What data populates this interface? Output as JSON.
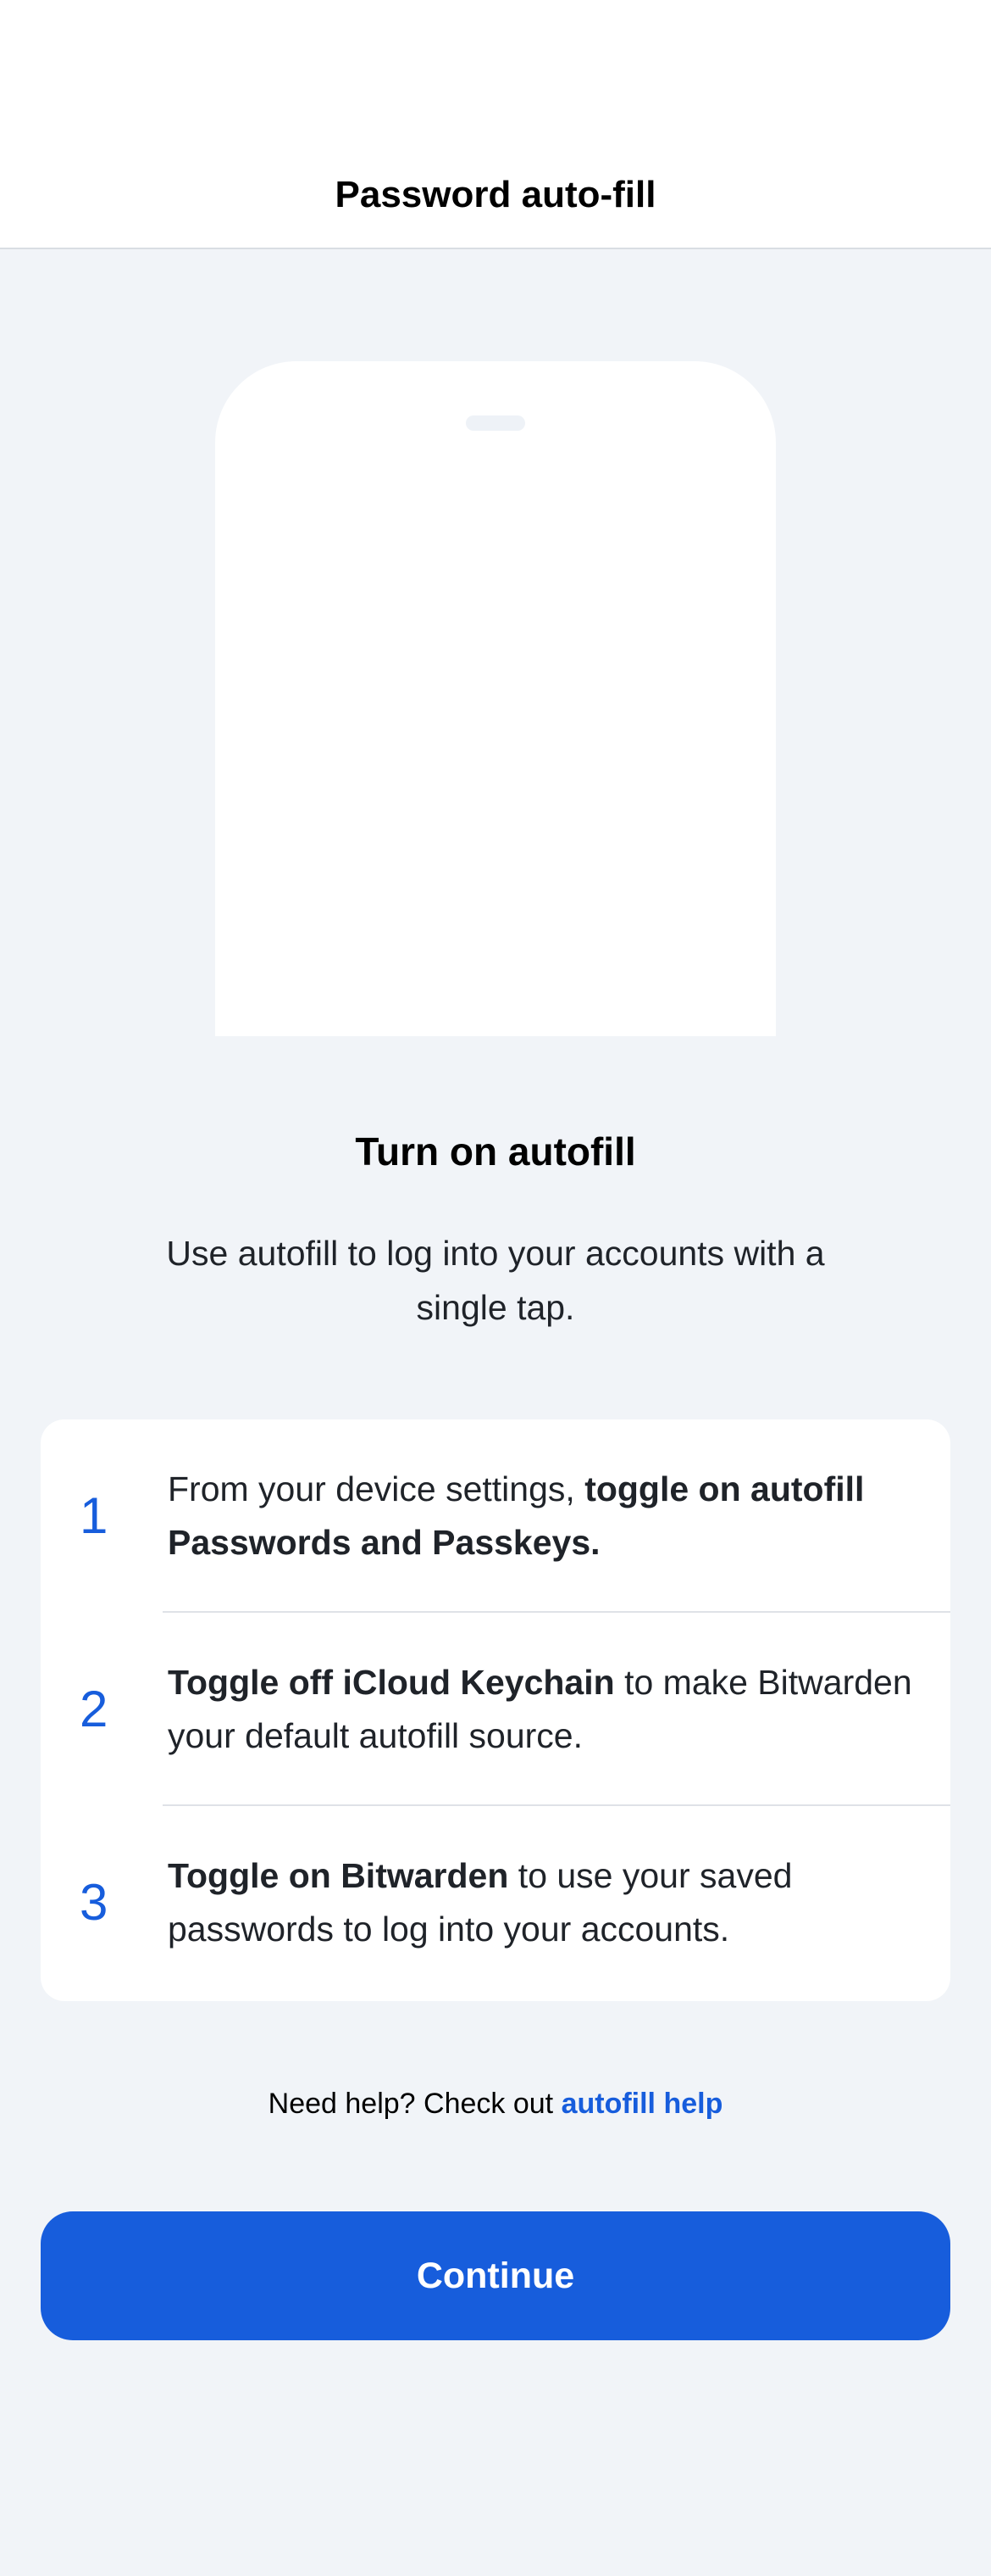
{
  "header": {
    "title": "Password auto-fill"
  },
  "hero": {
    "title": "Turn on autofill",
    "subtitle": "Use autofill to log into your accounts with a single tap."
  },
  "steps": [
    {
      "number": "1",
      "pre": "From your device settings, ",
      "bold": "toggle on autofill Passwords and Passkeys.",
      "post": ""
    },
    {
      "number": "2",
      "pre": "",
      "bold": "Toggle off iCloud Keychain",
      "post": " to make Bitwarden your default autofill source."
    },
    {
      "number": "3",
      "pre": "",
      "bold": "Toggle on Bitwarden",
      "post": " to use your saved passwords to log into your accounts."
    }
  ],
  "help": {
    "prefix": "Need help? Check out ",
    "link_label": "autofill help"
  },
  "continue_label": "Continue",
  "colors": {
    "accent": "#175ddc",
    "background": "#f1f4f8",
    "card": "#ffffff"
  }
}
